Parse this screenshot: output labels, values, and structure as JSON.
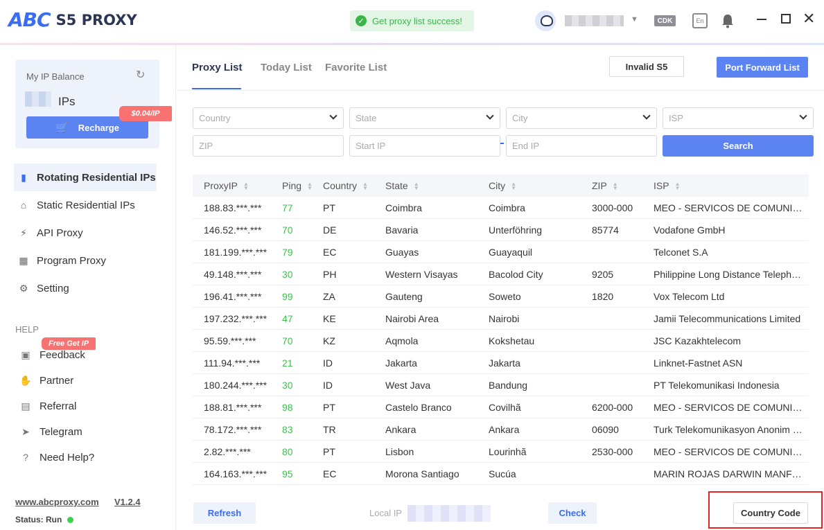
{
  "app": {
    "logo_mark": "ABC",
    "logo_text": "S5 PROXY"
  },
  "toast": {
    "text": "Get proxy list success!"
  },
  "header": {
    "cdk": "CDK",
    "lang": "En"
  },
  "sidebar": {
    "balance_label": "My IP Balance",
    "balance_unit": "IPs",
    "recharge": "Recharge",
    "price_tag": "$0.04/IP",
    "nav": [
      {
        "label": "Rotating Residential IPs",
        "icon": "phone-icon"
      },
      {
        "label": "Static Residential IPs",
        "icon": "home-icon"
      },
      {
        "label": "API Proxy",
        "icon": "plug-icon"
      },
      {
        "label": "Program Proxy",
        "icon": "grid-icon"
      },
      {
        "label": "Setting",
        "icon": "gear-icon"
      }
    ],
    "help_label": "HELP",
    "free_tag": "Free Get IP",
    "help": [
      {
        "label": "Feedback",
        "icon": "feedback-icon"
      },
      {
        "label": "Partner",
        "icon": "handshake-icon"
      },
      {
        "label": "Referral",
        "icon": "referral-icon"
      },
      {
        "label": "Telegram",
        "icon": "telegram-icon"
      },
      {
        "label": "Need Help?",
        "icon": "question-icon"
      }
    ],
    "website": "www.abcproxy.com",
    "version": "V1.2.4",
    "status": "Status: Run"
  },
  "tabs": [
    "Proxy List",
    "Today List",
    "Favorite List"
  ],
  "actions": {
    "invalid": "Invalid S5",
    "port_forward": "Port Forward List"
  },
  "filters": {
    "country": "Country",
    "state": "State",
    "city": "City",
    "isp": "ISP",
    "zip": "ZIP",
    "start_ip": "Start IP",
    "end_ip": "End IP",
    "search": "Search"
  },
  "table": {
    "headers": [
      "ProxyIP",
      "Ping",
      "Country",
      "State",
      "City",
      "ZIP",
      "ISP"
    ],
    "rows": [
      [
        "188.83.***.***",
        "77",
        "PT",
        "Coimbra",
        "Coimbra",
        "3000-000",
        "MEO - SERVICOS DE COMUNICACOES E MULTIMEDIA S.A."
      ],
      [
        "146.52.***.***",
        "70",
        "DE",
        "Bavaria",
        "Unterföhring",
        "85774",
        "Vodafone GmbH"
      ],
      [
        "181.199.***.***",
        "79",
        "EC",
        "Guayas",
        "Guayaquil",
        "",
        "Telconet S.A"
      ],
      [
        "49.148.***.***",
        "30",
        "PH",
        "Western Visayas",
        "Bacolod City",
        "9205",
        "Philippine Long Distance Telephone Company"
      ],
      [
        "196.41.***.***",
        "99",
        "ZA",
        "Gauteng",
        "Soweto",
        "1820",
        "Vox Telecom Ltd"
      ],
      [
        "197.232.***.***",
        "47",
        "KE",
        "Nairobi Area",
        "Nairobi",
        "",
        "Jamii Telecommunications Limited"
      ],
      [
        "95.59.***.***",
        "70",
        "KZ",
        "Aqmola",
        "Kokshetau",
        "",
        "JSC Kazakhtelecom"
      ],
      [
        "111.94.***.***",
        "21",
        "ID",
        "Jakarta",
        "Jakarta",
        "",
        "Linknet-Fastnet ASN"
      ],
      [
        "180.244.***.***",
        "30",
        "ID",
        "West Java",
        "Bandung",
        "",
        "PT Telekomunikasi Indonesia"
      ],
      [
        "188.81.***.***",
        "98",
        "PT",
        "Castelo Branco",
        "Covilhã",
        "6200-000",
        "MEO - SERVICOS DE COMUNICACOES E MULTIMEDIA S.A."
      ],
      [
        "78.172.***.***",
        "83",
        "TR",
        "Ankara",
        "Ankara",
        "06090",
        "Turk Telekomunikasyon Anonim Sirketi"
      ],
      [
        "2.82.***.***",
        "80",
        "PT",
        "Lisbon",
        "Lourinhã",
        "2530-000",
        "MEO - SERVICOS DE COMUNICACOES E MULTIMEDIA S.A."
      ],
      [
        "164.163.***.***",
        "95",
        "EC",
        "Morona Santiago",
        "Sucúa",
        "",
        "MARIN ROJAS DARWIN MANFREDO"
      ]
    ]
  },
  "footer": {
    "refresh": "Refresh",
    "local_ip_label": "Local IP",
    "check": "Check",
    "country_code": "Country Code"
  }
}
